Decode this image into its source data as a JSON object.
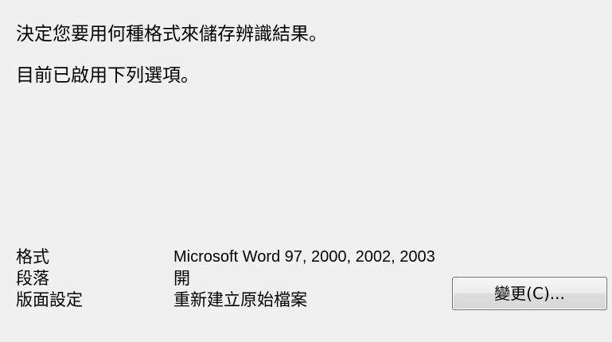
{
  "intro": "決定您要用何種格式來儲存辨識結果。",
  "status": "目前已啟用下列選項。",
  "settings": [
    {
      "label": "格式",
      "value": "Microsoft Word 97, 2000, 2002, 2003"
    },
    {
      "label": "段落",
      "value": "開"
    },
    {
      "label": "版面設定",
      "value": "重新建立原始檔案"
    }
  ],
  "change_button_label": "變更(C)..."
}
